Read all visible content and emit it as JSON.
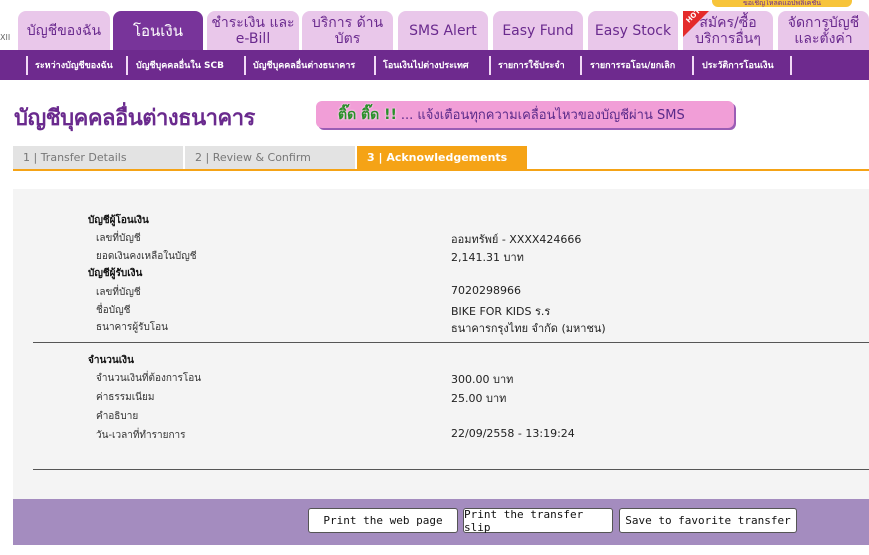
{
  "topbar": {
    "left_stub": "ХII",
    "promo_strip": "ขอเชิญโหลดแอปพลิเคชัน",
    "hot_badge": "HOT",
    "tabs": [
      {
        "label": "บัญชีของฉัน"
      },
      {
        "label": "โอนเงิน"
      },
      {
        "label": "ชำระเงิน และ e-Bill"
      },
      {
        "label": "บริการ ด้านบัตร"
      },
      {
        "label": "SMS Alert"
      },
      {
        "label": "Easy Fund"
      },
      {
        "label": "Easy Stock"
      },
      {
        "label": "สมัคร/ซื้อ บริการอื่นๆ"
      },
      {
        "label": "จัดการบัญชี และตั้งค่า"
      }
    ]
  },
  "subnav": {
    "items": [
      {
        "label": "ระหว่างบัญชีของฉัน"
      },
      {
        "label": "บัญชีบุคคลอื่นใน SCB"
      },
      {
        "label": "บัญชีบุคคลอื่นต่างธนาคาร"
      },
      {
        "label": "โอนเงินไปต่างประเทศ"
      },
      {
        "label": "รายการใช้ประจำ"
      },
      {
        "label": "รายการรอโอน/ยกเลิก"
      },
      {
        "label": "ประวัติการโอนเงิน"
      }
    ]
  },
  "page": {
    "title": "บัญชีบุคคลอื่นต่างธนาคาร",
    "promo_highlight": "ติ๊ด ติ๊ด !!",
    "promo_text": "... แจ้งเตือนทุกความเคลื่อนไหวของบัญชีผ่าน SMS"
  },
  "steps": [
    {
      "label": "1 | Transfer Details"
    },
    {
      "label": "2 | Review & Confirm"
    },
    {
      "label": "3 | Acknowledgements"
    }
  ],
  "details": {
    "from_section": "บัญชีผู้โอนเงิน",
    "from_account_label": "เลขที่บัญชี",
    "from_account_value": "ออมทรัพย์ - XXXX424666",
    "balance_label": "ยอดเงินคงเหลือในบัญชี",
    "balance_value": "2,141.31  บาท",
    "to_section": "บัญชีผู้รับเงิน",
    "to_account_label": "เลขที่บัญชี",
    "to_account_value": "7020298966",
    "to_name_label": "ชื่อบัญชี",
    "to_name_value": "BIKE FOR KIDS ร.ร",
    "to_bank_label": "ธนาคารผู้รับโอน",
    "to_bank_value": "ธนาคารกรุงไทย จำกัด (มหาชน)",
    "amount_section": "จำนวนเงิน",
    "amount_label": "จำนวนเงินที่ต้องการโอน",
    "amount_value": "300.00  บาท",
    "fee_label": "ค่าธรรมเนียม",
    "fee_value": "25.00  บาท",
    "desc_label": "คำอธิบาย",
    "desc_value": "",
    "datetime_label": "วัน-เวลาที่ทำรายการ",
    "datetime_value": "22/09/2558 - 13:19:24"
  },
  "buttons": {
    "print_page": "Print the web page",
    "print_slip": "Print the transfer slip",
    "save_favorite": "Save to favorite transfer"
  }
}
